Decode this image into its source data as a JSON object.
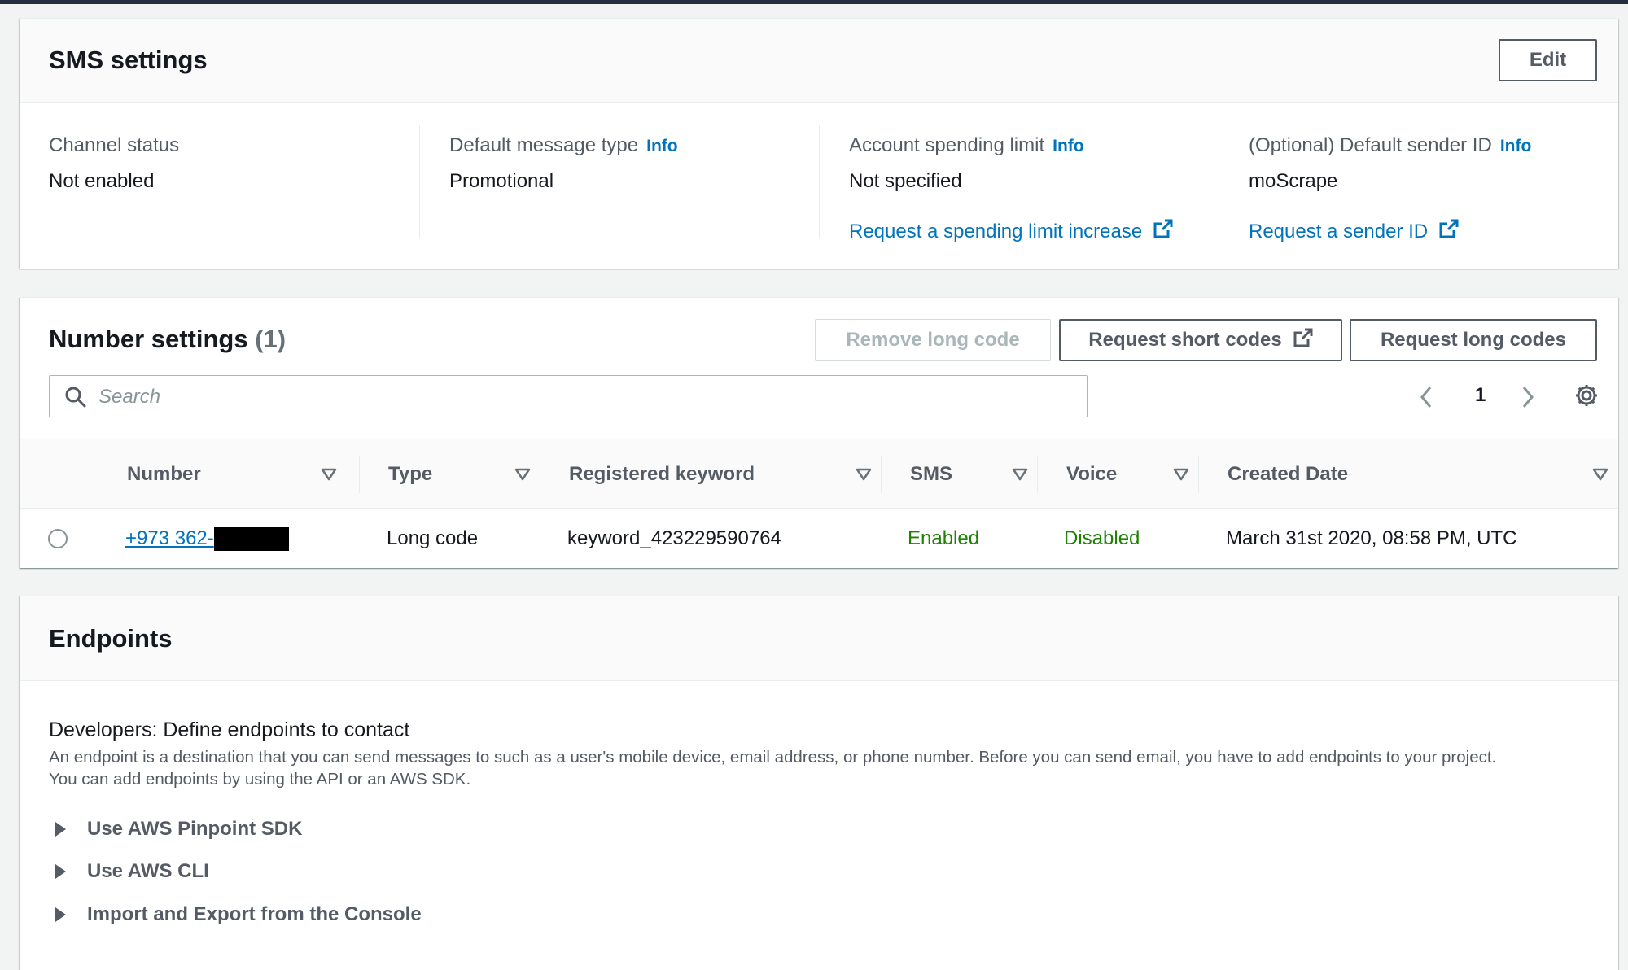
{
  "sms_settings": {
    "title": "SMS settings",
    "edit_label": "Edit",
    "fields": [
      {
        "label": "Channel status",
        "value": "Not enabled"
      },
      {
        "label": "Default message type",
        "info": "Info",
        "value": "Promotional"
      },
      {
        "label": "Account spending limit",
        "info": "Info",
        "value": "Not specified",
        "link": "Request a spending limit increase"
      },
      {
        "label": "(Optional) Default sender ID",
        "info": "Info",
        "value": "moScrape",
        "link": "Request a sender ID"
      }
    ]
  },
  "number_settings": {
    "title": "Number settings",
    "count": "(1)",
    "remove_label": "Remove long code",
    "request_short_label": "Request short codes",
    "request_long_label": "Request long codes",
    "search_placeholder": "Search",
    "page_number": "1",
    "columns": [
      "Number",
      "Type",
      "Registered keyword",
      "SMS",
      "Voice",
      "Created Date"
    ],
    "rows": [
      {
        "number": "+973 362-",
        "type": "Long code",
        "keyword": "keyword_423229590764",
        "sms": "Enabled",
        "voice": "Disabled",
        "created": "March 31st 2020, 08:58 PM, UTC"
      }
    ]
  },
  "endpoints": {
    "title": "Endpoints",
    "heading": "Developers: Define endpoints to contact",
    "description_line1": "An endpoint is a destination that you can send messages to such as a user's mobile device, email address, or phone number. Before you can send email, you have to add endpoints to your project.",
    "description_line2": "You can add endpoints by using the API or an AWS SDK.",
    "expanders": [
      "Use AWS Pinpoint SDK",
      "Use AWS CLI",
      "Import and Export from the Console"
    ]
  },
  "colors": {
    "link": "#0073bb",
    "success": "#1d8102",
    "text": "#16191f",
    "muted": "#545b64"
  }
}
